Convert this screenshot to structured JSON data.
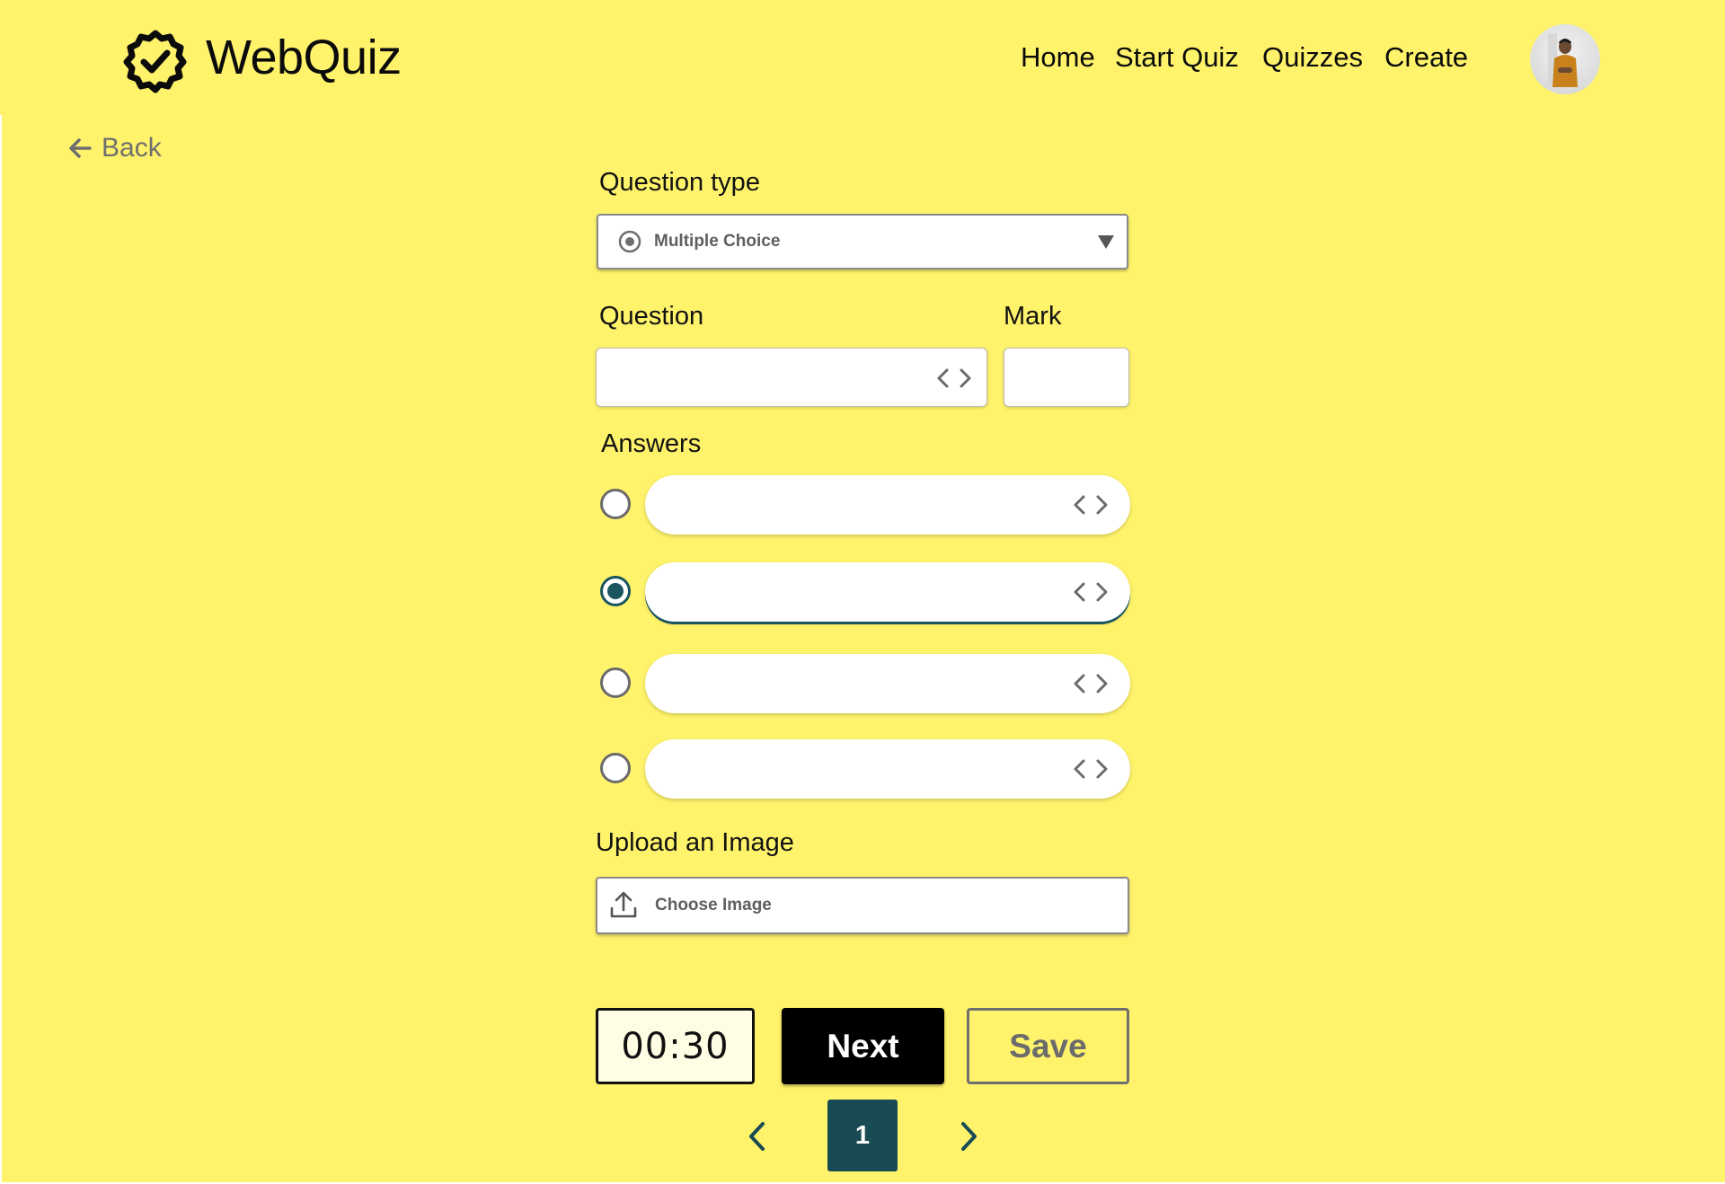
{
  "header": {
    "brand": "WebQuiz",
    "logo_icon": "badge-check-icon",
    "nav": [
      "Home",
      "Start Quiz",
      "Quizzes",
      "Create"
    ],
    "avatar_icon": "user-avatar"
  },
  "back": {
    "label": "Back",
    "icon": "arrow-left-icon"
  },
  "form": {
    "question_type_label": "Question type",
    "question_type_value": "Multiple Choice",
    "question_label": "Question",
    "question_value": "",
    "mark_label": "Mark",
    "mark_value": "",
    "answers_label": "Answers",
    "answers": [
      {
        "value": "",
        "selected": false
      },
      {
        "value": "",
        "selected": true
      },
      {
        "value": "",
        "selected": false
      },
      {
        "value": "",
        "selected": false
      }
    ],
    "upload_label": "Upload an Image",
    "upload_button": "Choose Image",
    "timer": "00:30",
    "next_label": "Next",
    "save_label": "Save"
  },
  "pagination": {
    "current": "1"
  },
  "colors": {
    "background": "#fff36b",
    "accent": "#184b54",
    "primary_button": "#000000"
  }
}
